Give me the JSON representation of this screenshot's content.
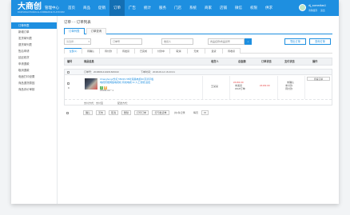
{
  "brand": {
    "logo_text": "大商创",
    "logo_sub": "DASHANGCHUANG E-COMMERCE PLATFORM",
    "admin_label": "管理中心"
  },
  "top_nav": [
    "首页",
    "商品",
    "促销",
    "订单",
    "广告",
    "統计",
    "服务",
    "门店",
    "系统",
    "商家",
    "店铺",
    "微信",
    "权限",
    "供求"
  ],
  "user": {
    "name": "dj_scmedias1",
    "actions": [
      "清除缓存",
      "退出"
    ]
  },
  "sidebar": [
    "订单列表",
    "新增订单",
    "发货单列表",
    "退货单列表",
    "售后申请",
    "延迟收货",
    "申请退款",
    "取消退款",
    "电面打印设置",
    "商品退货原因",
    "商品评价审核"
  ],
  "page": {
    "title": "订单 - - 订单列表",
    "tabs": [
      "订单列表",
      "订单查询"
    ]
  },
  "filters": {
    "select1": "请选择...",
    "order_no_placeholder": "订单号",
    "consignee_placeholder": "收货人",
    "goods_placeholder": "商品名称/商品货号",
    "search_icon": "search-icon",
    "export_btn": "导出订单",
    "query_btn": "查询订单"
  },
  "status_tabs": [
    "全部(1)",
    "待确认",
    "待付款",
    "待发货",
    "已完成",
    "付款中",
    "取消",
    "无效",
    "退货",
    "待收货"
  ],
  "table_headers": [
    "编号",
    "商品信息",
    "收货人",
    "总金额",
    "订单状态",
    "支付状态",
    "操作"
  ],
  "order": {
    "order_label": "订单号：2018061410261609010",
    "time_label": "下单时间：2018-06-14 16:23:21",
    "view_btn": "查看订单",
    "index": "9",
    "goods_name": "Changhong/长虹 55D3S 55吋液晶电视4K高清平板电视智能网络电视机 有线电视 AI 人工智能 遥控",
    "goods_price": "¥4099.00 * 1",
    "consignee": "王某某",
    "total": "¥4163.00",
    "pay_method_label": "支付方式：支付宝",
    "order_amount": "¥4163.00",
    "pay_method_cell": "WAP订单",
    "order_status_lines": [
      "未确认",
      "未付款",
      "未发货"
    ],
    "pay_status": "待付款",
    "pay_line": "支付方式：支付宝",
    "ship_line": "配送方式：",
    "colors": {
      "accent": "#1e8fe0",
      "price_red": "#e64545",
      "tag_green": "#5cb85c",
      "tag_orange": "#f0ad4e"
    }
  },
  "bulk": {
    "buttons": [
      "确认",
      "无效",
      "取消",
      "删除",
      "打印订单",
      "打印发货单"
    ],
    "pager_total": "共1条记录",
    "pager_page": "每页",
    "page_size": "15"
  }
}
